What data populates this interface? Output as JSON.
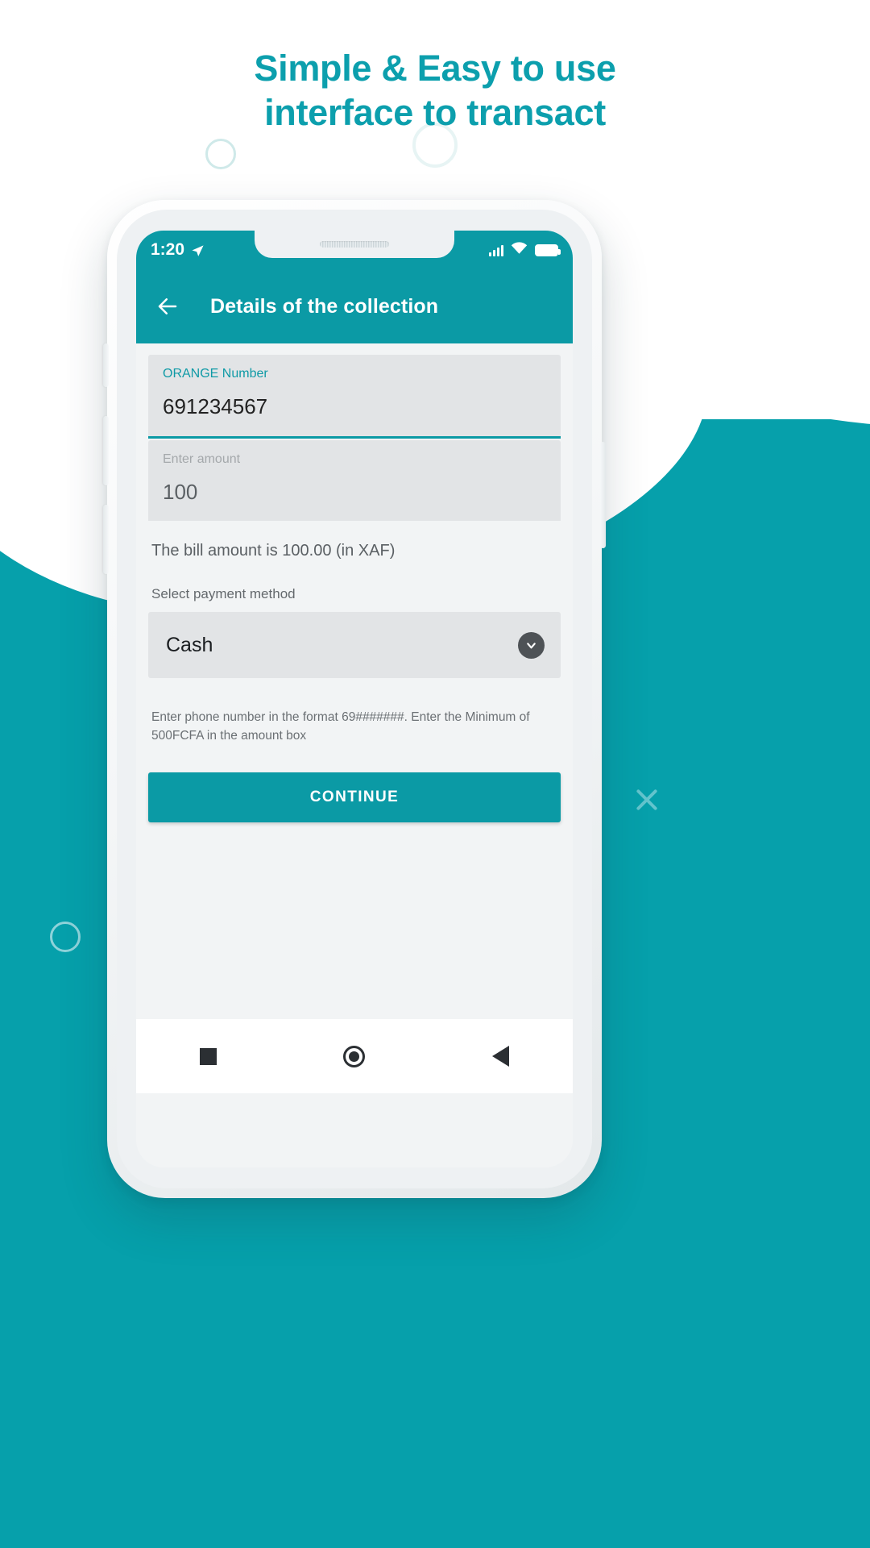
{
  "headline": {
    "line1": "Simple & Easy to use",
    "line2": "interface to transact",
    "color": "#0c9fad"
  },
  "theme": {
    "accent": "#0b9aa5",
    "background": "#06a0ab",
    "field_bg": "#e2e4e6",
    "screen_bg": "#f2f4f5"
  },
  "phone": {
    "status_bar": {
      "time": "1:20",
      "location_icon": "location-arrow-icon",
      "signal_icon": "signal-bars-icon",
      "wifi_icon": "wifi-icon",
      "battery_icon": "battery-full-icon"
    },
    "app_bar": {
      "back_icon": "back-arrow-icon",
      "title": "Details of the collection"
    },
    "form": {
      "phone_field": {
        "label": "ORANGE Number",
        "value": "691234567",
        "placeholder": "ORANGE Number"
      },
      "amount_field": {
        "label": "Enter amount",
        "value": "100",
        "placeholder": "Enter amount"
      },
      "bill_note": "The bill amount is 100.00 (in XAF)",
      "payment_method": {
        "label": "Select payment method",
        "selected": "Cash",
        "dropdown_icon": "chevron-down-icon",
        "options": [
          "Cash"
        ]
      },
      "hint": "Enter phone number in the format 69#######. Enter the Minimum of 500FCFA in the amount box",
      "continue_label": "CONTINUE"
    },
    "nav_bar": {
      "recents_icon": "square-recents-icon",
      "home_icon": "circle-home-icon",
      "back_icon": "triangle-back-icon"
    }
  },
  "decorations": {
    "close_icon": "close-x-icon",
    "ring_icon": "circle-outline-icon"
  }
}
